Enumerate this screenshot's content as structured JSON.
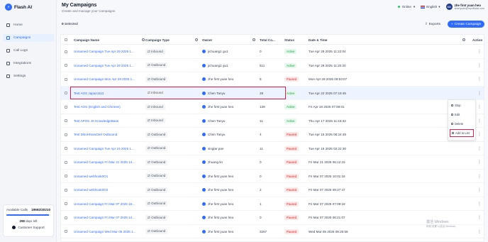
{
  "brand": {
    "name": "Flash AI"
  },
  "sidebar": {
    "items": [
      {
        "label": "Home",
        "icon": "home-icon"
      },
      {
        "label": "Campaigns",
        "icon": "campaign-icon",
        "active": true
      },
      {
        "label": "Call Logs",
        "icon": "call-log-icon"
      },
      {
        "label": "Integrations",
        "icon": "integration-icon"
      },
      {
        "label": "Settings",
        "icon": "gear-icon"
      }
    ],
    "calls": {
      "label": "Available Calls",
      "value": "19592/20210",
      "fraction": 0.969,
      "days": "258",
      "days_label": "days left",
      "support": "Customer Support"
    }
  },
  "header": {
    "title": "My Campaigns",
    "subtitle": "Create and manage your Campaigns",
    "status": "Online",
    "language": "English",
    "user_initials": "XO",
    "user_name": "zhe first yuan heo",
    "user_email": "zhenyuan@mynfirstai.com"
  },
  "toolbar": {
    "selected_count": "0",
    "selected_label": "Selected",
    "exports": "Exports",
    "create": "Create Campaign"
  },
  "table": {
    "headers": [
      "Campaign Name",
      "Campaign Type",
      "Owner",
      "Total Co...",
      "Status",
      "Date & Time",
      "Action"
    ],
    "rows": [
      {
        "name": "Unnamed Campaign Tue Apr 29 2025 1...",
        "type": "Inbound",
        "owner": "jichuang1 gu1",
        "total": "0",
        "status": "Active",
        "date": "Tue Apr 29 2025 11:22:04"
      },
      {
        "name": "Unnamed Campaign Tue Apr 29 2025 1...",
        "type": "Outbound",
        "owner": "jichuang1 gu1",
        "total": "511",
        "status": "Active",
        "date": "Tue Apr 29 2025 11:20:20"
      },
      {
        "name": "Unnamed Campaign Mon Apr 28 2025 1...",
        "type": "Outbound",
        "owner": "zhe first yuan heo",
        "total": "8",
        "status": "Paused",
        "date": "Mon Apr 28 2025 09:53:07"
      },
      {
        "name": "Test AOS Japan1112",
        "type": "Inbound",
        "owner": "Chen Tanyu",
        "total": "28",
        "status": "Active",
        "date": "Tue Apr 22 2025 07:19:45"
      },
      {
        "name": "Test AOS (English and Chinese)",
        "type": "Inbound",
        "owner": "zhe first yuan heo",
        "total": "139",
        "status": "Active",
        "date": "Fri Apr 18 2025 07:59:01"
      },
      {
        "name": "Test APOS JX KnowledgeBase",
        "type": "Inbound",
        "owner": "Chen Tanyu",
        "total": "11",
        "status": "Active",
        "date": "Thu Apr 17 2025 11:15:32"
      },
      {
        "name": "Test DNoHNowOtel Outbound",
        "type": "Outbound",
        "owner": "Chen Tanyu",
        "total": "4",
        "status": "Paused",
        "date": "Tue Apr 15 2025 06:24:49"
      },
      {
        "name": "Unnamed Campaign Tue Apr 15 2025 1...",
        "type": "Outbound",
        "owner": "singlar pan",
        "total": "11",
        "status": "Paused",
        "date": "Tue Apr 15 2025 02:22:30"
      },
      {
        "name": "Unnamed Campaign Fri Mar 21 2025 14...",
        "type": "Outbound",
        "owner": "zhuang lin",
        "total": "0",
        "status": "Paused",
        "date": "Fri Mar 21 2025 06:12:15"
      },
      {
        "name": "Unnamed webhook0O1",
        "type": "Outbound",
        "owner": "zhe first yuan heo",
        "total": "0",
        "status": "Paused",
        "date": "Fri Mar 07 2025 10:01:16"
      },
      {
        "name": "Unnamed webhook0O2",
        "type": "Outbound",
        "owner": "zhe first yuan heo",
        "total": "2",
        "status": "Paused",
        "date": "Fri Mar 07 2025 09:47:47"
      },
      {
        "name": "Unnamed Campaign Fri Mar 07 2025 15...",
        "type": "Outbound",
        "owner": "zhe first yuan heo",
        "total": "1",
        "status": "Paused",
        "date": "Fri Mar 07 2025 07:09:18"
      },
      {
        "name": "Unnamed Campaign Fri Mar 07 2025 14...",
        "type": "Outbound",
        "owner": "zhe first yuan heo",
        "total": "0",
        "status": "Paused",
        "date": "Fri Mar 07 2025 06:21:07"
      },
      {
        "name": "Unnamed Campaign Wed Mar 05 2025 1...",
        "type": "Outbound",
        "owner": "zhe first yuan heo",
        "total": "3267",
        "status": "Paused",
        "date": "Wed Mar 05 2025 08:25:56"
      }
    ]
  },
  "menu": {
    "items": [
      "Stop",
      "Edit",
      "Delete",
      "Add to List"
    ]
  },
  "watermark": {
    "line1": "激活 Windows",
    "line2": "转到\"设置\"以激活 Windows。"
  },
  "colors": {
    "accent": "#2f6bff",
    "active": "#16a34a",
    "paused": "#dc2626",
    "highlight_box": "#e11d48"
  }
}
